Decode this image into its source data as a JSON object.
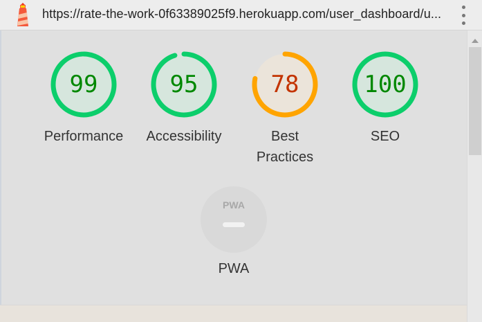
{
  "address_bar": {
    "url": "https://rate-the-work-0f63389025f9.herokuapp.com/user_dashboard/u..."
  },
  "categories": [
    {
      "id": "performance",
      "label": "Performance",
      "score": "99",
      "color": "#0cce6b",
      "text_color": "#008800",
      "fill": "#d6e6dd"
    },
    {
      "id": "accessibility",
      "label": "Accessibility",
      "score": "95",
      "color": "#0cce6b",
      "text_color": "#008800",
      "fill": "#d6e6dd"
    },
    {
      "id": "best_practices",
      "label": "Best Practices",
      "score": "78",
      "color": "#ffa400",
      "text_color": "#c33300",
      "fill": "#ebe4da"
    },
    {
      "id": "seo",
      "label": "SEO",
      "score": "100",
      "color": "#0cce6b",
      "text_color": "#008800",
      "fill": "#d6e6dd"
    }
  ],
  "pwa": {
    "label": "PWA",
    "badge_text": "PWA"
  },
  "icons": {
    "app": "lighthouse-icon",
    "menu": "more-vertical-icon"
  }
}
